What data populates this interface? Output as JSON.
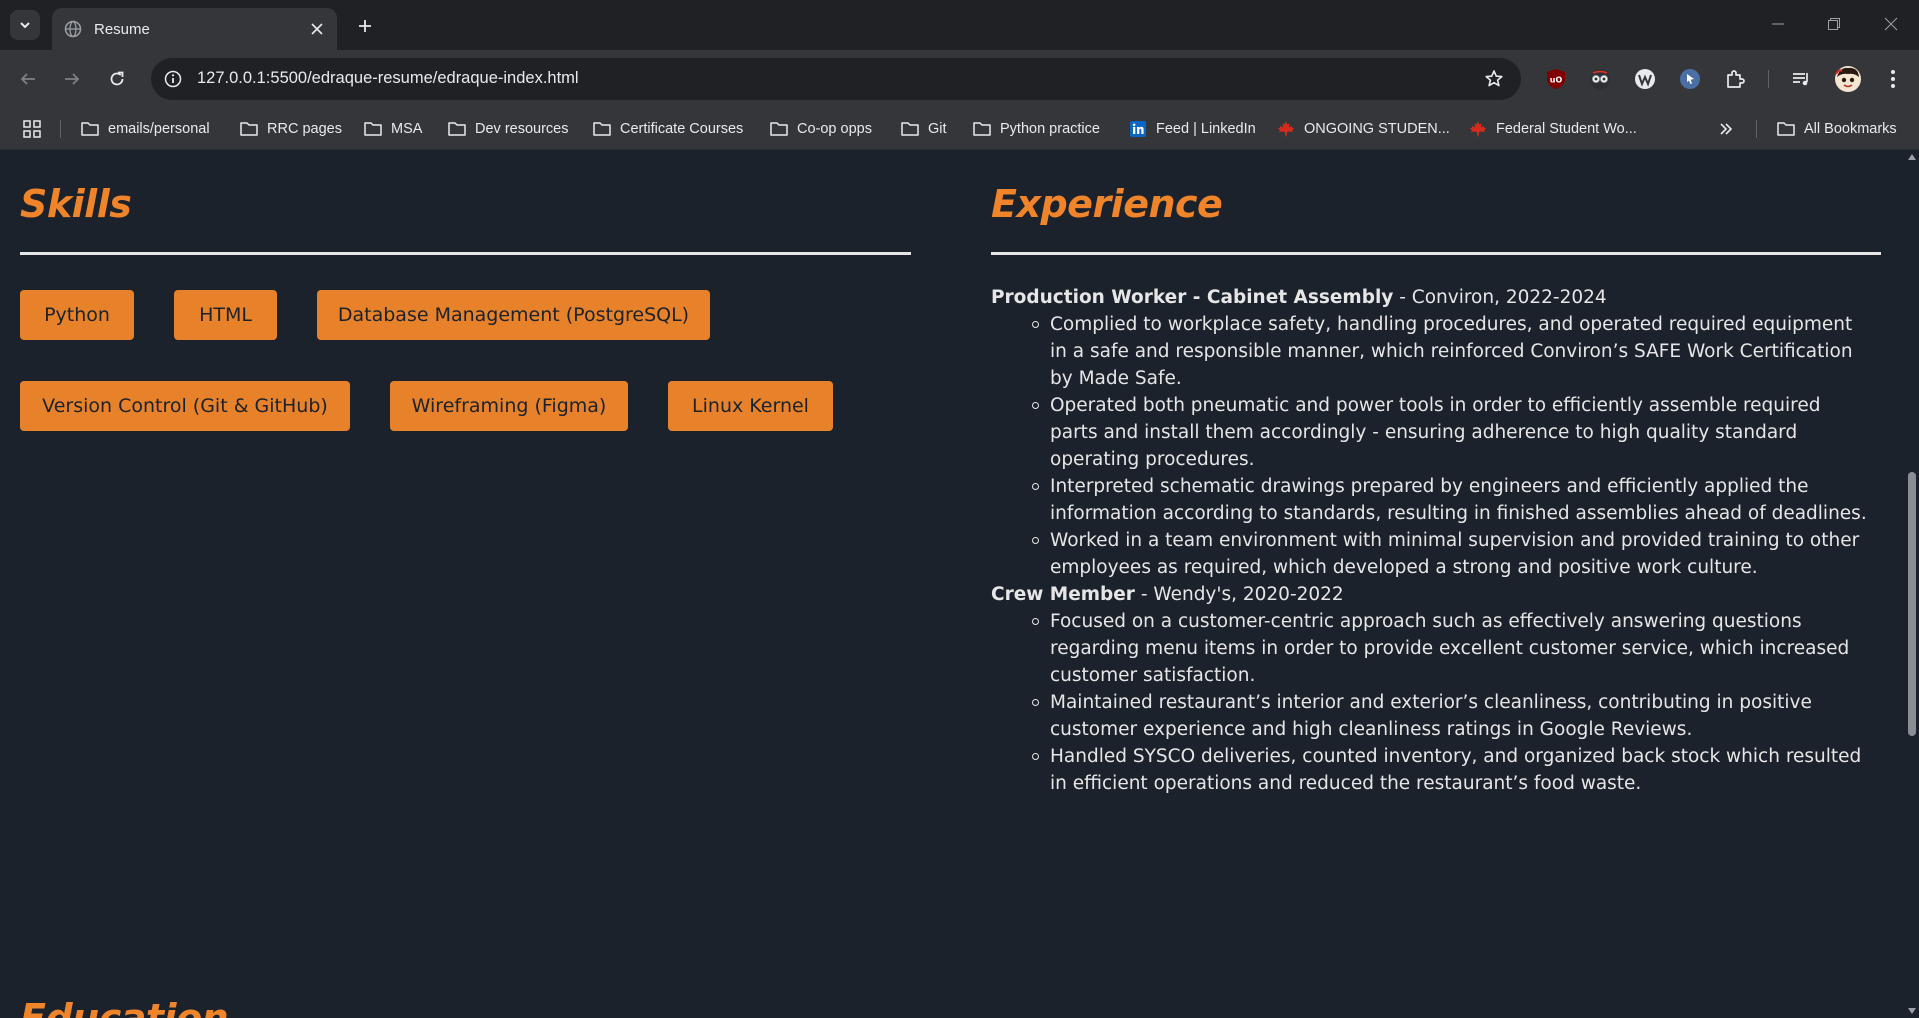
{
  "browser": {
    "tab_title": "Resume",
    "url": "127.0.0.1:5500/edraque-resume/edraque-index.html",
    "bookmarks": [
      {
        "label": "emails/personal",
        "icon": "folder-icon"
      },
      {
        "label": "RRC pages",
        "icon": "folder-icon"
      },
      {
        "label": "MSA",
        "icon": "folder-icon"
      },
      {
        "label": "Dev resources",
        "icon": "folder-icon"
      },
      {
        "label": "Certificate Courses",
        "icon": "folder-icon"
      },
      {
        "label": "Co-op opps",
        "icon": "folder-icon"
      },
      {
        "label": "Git",
        "icon": "folder-icon"
      },
      {
        "label": "Python practice",
        "icon": "folder-icon"
      },
      {
        "label": "Feed | LinkedIn",
        "icon": "linkedin-icon"
      },
      {
        "label": "ONGOING STUDEN...",
        "icon": "maple-leaf-icon"
      },
      {
        "label": "Federal Student Wo...",
        "icon": "maple-leaf-icon"
      }
    ],
    "all_bookmarks_label": "All Bookmarks"
  },
  "page": {
    "skills_title": "Skills",
    "experience_title": "Experience",
    "education_title": "Education",
    "skills": [
      "Python",
      "HTML",
      "Database Management (PostgreSQL)",
      "Version Control (Git & GitHub)",
      "Wireframing (Figma)",
      "Linux Kernel"
    ],
    "jobs": [
      {
        "role": "Production Worker - Cabinet Assembly",
        "detail": " - Conviron, 2022-2024",
        "bullets": [
          "Complied to workplace safety, handling procedures, and operated required equipment in a safe and responsible manner, which reinforced Conviron’s SAFE Work Certification by Made Safe.",
          "Operated both pneumatic and power tools in order to efficiently assemble required parts and install them accordingly - ensuring adherence to high quality standard operating procedures.",
          "Interpreted schematic drawings prepared by engineers and efficiently applied the information according to standards, resulting in finished assemblies ahead of deadlines.",
          "Worked in a team environment with minimal supervision and provided training to other employees as required, which developed a strong and positive work culture."
        ]
      },
      {
        "role": "Crew Member",
        "detail": " - Wendy's, 2020-2022",
        "bullets": [
          "Focused on a customer-centric approach such as effectively answering questions regarding menu items in order to provide excellent customer service, which increased customer satisfaction.",
          "Maintained restaurant’s interior and exterior’s cleanliness, contributing in positive customer experience and high cleanliness ratings in Google Reviews.",
          "Handled SYSCO deliveries, counted inventory, and organized back stock which resulted in efficient operations and reduced the restaurant’s food waste."
        ]
      }
    ]
  },
  "colors": {
    "accent": "#e8822a",
    "page_bg": "#1b222c",
    "text": "#e6e6e6"
  }
}
